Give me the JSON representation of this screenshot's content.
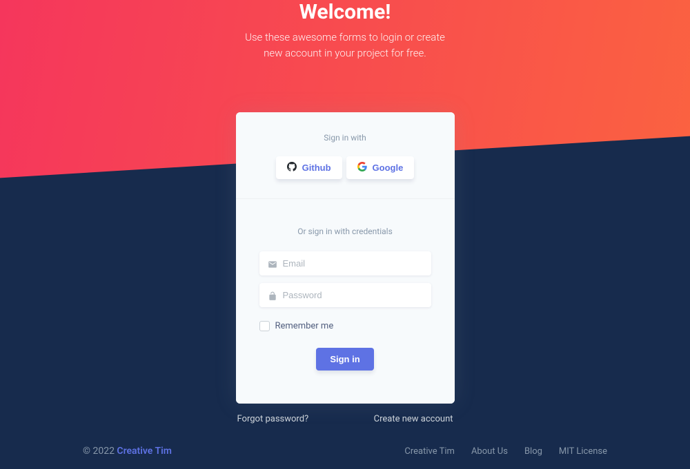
{
  "header": {
    "title": "Welcome!",
    "subtitle": "Use these awesome forms to login or create new account in your project for free."
  },
  "card": {
    "signin_with": "Sign in with",
    "social": {
      "github": "Github",
      "google": "Google"
    },
    "credentials_label": "Or sign in with credentials",
    "inputs": {
      "email_placeholder": "Email",
      "password_placeholder": "Password"
    },
    "remember_label": "Remember me",
    "signin_button": "Sign in"
  },
  "links": {
    "forgot": "Forgot password?",
    "create": "Create new account"
  },
  "footer": {
    "copyright_prefix": "© 2022 ",
    "brand": "Creative Tim",
    "nav": [
      "Creative Tim",
      "About Us",
      "Blog",
      "MIT License"
    ]
  }
}
